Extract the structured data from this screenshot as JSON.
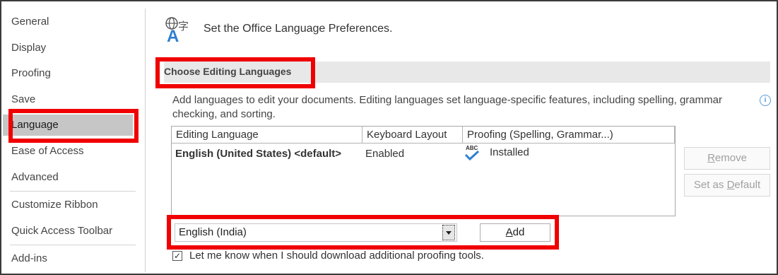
{
  "sidebar": {
    "items": [
      {
        "label": "General"
      },
      {
        "label": "Display"
      },
      {
        "label": "Proofing"
      },
      {
        "label": "Save"
      },
      {
        "label": "Language"
      },
      {
        "label": "Ease of Access"
      },
      {
        "label": "Advanced"
      },
      {
        "label": "Customize Ribbon"
      },
      {
        "label": "Quick Access Toolbar"
      },
      {
        "label": "Add-ins"
      }
    ],
    "selected": "Language"
  },
  "header": {
    "title": "Set the Office Language Preferences.",
    "icon": "language-icon"
  },
  "section": {
    "title": "Choose Editing Languages",
    "description": "Add languages to edit your documents. Editing languages set language-specific features, including spelling, grammar checking, and sorting."
  },
  "table": {
    "columns": [
      "Editing Language",
      "Keyboard Layout",
      "Proofing (Spelling, Grammar...)"
    ],
    "rows": [
      {
        "language": "English (United States) <default>",
        "keyboard": "Enabled",
        "proofing": "Installed",
        "proofing_icon": "abc-check-icon"
      }
    ]
  },
  "buttons": {
    "remove": {
      "before": "",
      "accel": "R",
      "after": "emove"
    },
    "set_default": {
      "before": "Set as ",
      "accel": "D",
      "after": "efault"
    },
    "add": {
      "before": "",
      "accel": "A",
      "after": "dd"
    }
  },
  "language_select": {
    "value": "English (India)"
  },
  "checkbox": {
    "label": "Let me know when I should download additional proofing tools.",
    "checked": true,
    "mark": "✓"
  },
  "colors": {
    "highlight": "#f00000",
    "selected_bg": "#c6c6c6",
    "section_bg": "#e8e8e8"
  }
}
